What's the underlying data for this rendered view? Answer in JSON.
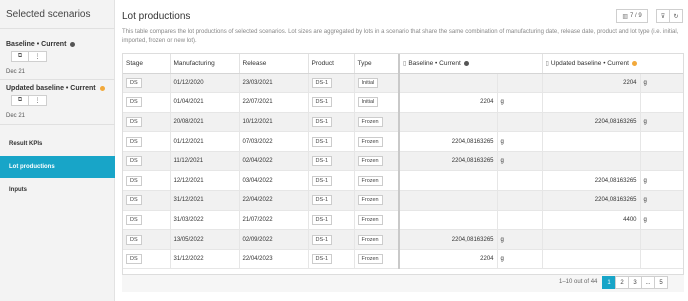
{
  "sidebar": {
    "title": "Selected scenarios",
    "scenarios": [
      {
        "name": "Baseline • Current",
        "date": "Dec 21",
        "color": "#555555"
      },
      {
        "name": "Updated baseline • Current",
        "date": "Dec 21",
        "color": "#f2a93b"
      }
    ],
    "buttons": {
      "copy": "⧉",
      "more": "⋮"
    },
    "nav": [
      {
        "label": "Result KPIs",
        "active": false
      },
      {
        "label": "Lot productions",
        "active": true
      },
      {
        "label": "Inputs",
        "active": false
      }
    ]
  },
  "main": {
    "title": "Lot productions",
    "description": "This table compares the lot productions of selected scenarios. Lot sizes are aggregated by lots in a scenario that share the same combination of manufacturing date, release date, product and lot type (i.e. initial, imported, frozen or new lot).",
    "columns_button": "7 / 9",
    "filter_icon": "⊽",
    "refresh_icon": "↻",
    "accent": "#18a5c8"
  },
  "table": {
    "headers": [
      "Stage",
      "Manufacturing",
      "Release",
      "Product",
      "Type",
      "Baseline • Current",
      "Updated baseline • Current"
    ],
    "rows": [
      [
        "DS",
        "01/12/2020",
        "23/03/2021",
        "DS-1",
        "Initial",
        "",
        "",
        "2204",
        "g"
      ],
      [
        "DS",
        "01/04/2021",
        "22/07/2021",
        "DS-1",
        "Initial",
        "2204",
        "g",
        "",
        ""
      ],
      [
        "DS",
        "20/08/2021",
        "10/12/2021",
        "DS-1",
        "Frozen",
        "",
        "",
        "2204,08163265",
        "g"
      ],
      [
        "DS",
        "01/12/2021",
        "07/03/2022",
        "DS-1",
        "Frozen",
        "2204,08163265",
        "g",
        "",
        ""
      ],
      [
        "DS",
        "11/12/2021",
        "02/04/2022",
        "DS-1",
        "Frozen",
        "2204,08163265",
        "g",
        "",
        ""
      ],
      [
        "DS",
        "12/12/2021",
        "03/04/2022",
        "DS-1",
        "Frozen",
        "",
        "",
        "2204,08163265",
        "g"
      ],
      [
        "DS",
        "31/12/2021",
        "22/04/2022",
        "DS-1",
        "Frozen",
        "",
        "",
        "2204,08163265",
        "g"
      ],
      [
        "DS",
        "31/03/2022",
        "21/07/2022",
        "DS-1",
        "Frozen",
        "",
        "",
        "4400",
        "g"
      ],
      [
        "DS",
        "13/05/2022",
        "02/09/2022",
        "DS-1",
        "Frozen",
        "2204,08163265",
        "g",
        "",
        ""
      ],
      [
        "DS",
        "31/12/2022",
        "22/04/2023",
        "DS-1",
        "Frozen",
        "2204",
        "g",
        "",
        ""
      ]
    ]
  },
  "pagination": {
    "summary": "1–10 out of 44",
    "pages": [
      "1",
      "2",
      "3",
      "...",
      "5"
    ],
    "active": "1"
  }
}
